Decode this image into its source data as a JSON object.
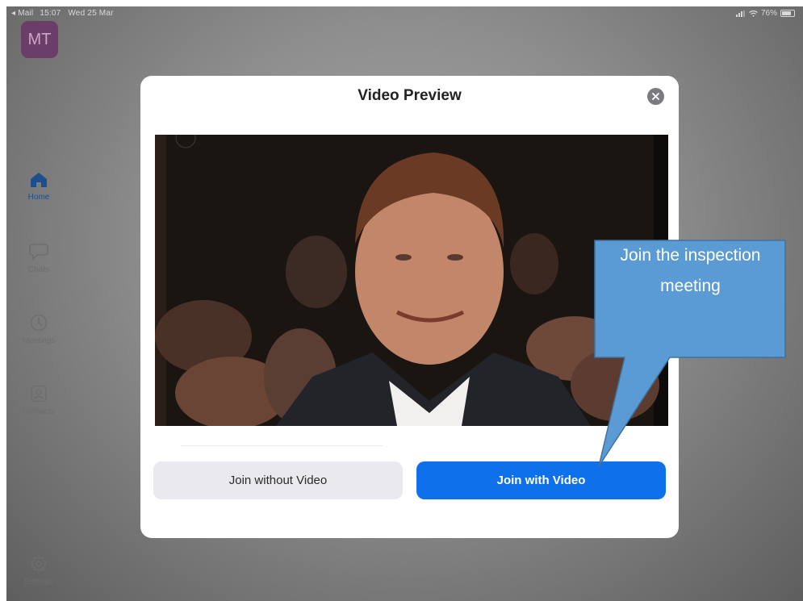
{
  "status_bar": {
    "back_app": "◂ Mail",
    "time": "15:07",
    "date": "Wed 25 Mar",
    "battery": "76%"
  },
  "sidebar": {
    "avatar_initials": "MT",
    "items": [
      {
        "label": "Home",
        "icon": "home-icon",
        "active": true
      },
      {
        "label": "Chats",
        "icon": "chat-bubble-icon",
        "active": false
      },
      {
        "label": "Meetings",
        "icon": "clock-icon",
        "active": false
      },
      {
        "label": "Contacts",
        "icon": "contact-card-icon",
        "active": false
      }
    ],
    "settings_label": "Settings"
  },
  "modal": {
    "title": "Video Preview",
    "join_without_video_label": "Join without Video",
    "join_with_video_label": "Join with Video"
  },
  "callout": {
    "text": "Join the inspection meeting"
  },
  "colors": {
    "accent": "#0e71eb",
    "callout": "#5b9bd5",
    "avatar": "#6b3d69"
  }
}
